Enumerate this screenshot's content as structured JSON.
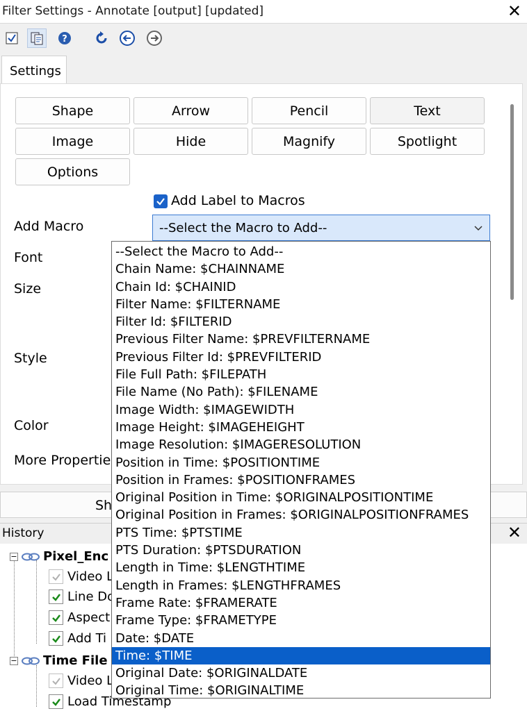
{
  "window": {
    "title": "Filter Settings - Annotate [output] [updated]",
    "close": "✕"
  },
  "toolbar": {
    "icons": [
      "apply-check-icon",
      "settings-copy-icon",
      "help-icon",
      "reset-icon",
      "back-arrow-icon",
      "forward-arrow-icon"
    ]
  },
  "tabs": [
    {
      "label": "Settings"
    }
  ],
  "tool_buttons": [
    "Shape",
    "Arrow",
    "Pencil",
    "Text",
    "Image",
    "Hide",
    "Magnify",
    "Spotlight",
    "Options"
  ],
  "add_label_checkbox": {
    "label": "Add Label to Macros",
    "checked": true
  },
  "form_labels": {
    "add_macro": "Add Macro",
    "font": "Font",
    "size": "Size",
    "style": "Style",
    "color": "Color",
    "more_properties": "More Properties"
  },
  "macro_select": {
    "value": "--Select the Macro to Add--"
  },
  "macro_options": [
    "--Select the Macro to Add--",
    "Chain Name: $CHAINNAME",
    "Chain Id: $CHAINID",
    "Filter Name: $FILTERNAME",
    "Filter Id: $FILTERID",
    "Previous Filter Name: $PREVFILTERNAME",
    "Previous Filter Id: $PREVFILTERID",
    "File Full Path: $FILEPATH",
    "File Name (No Path): $FILENAME",
    "Image Width: $IMAGEWIDTH",
    "Image Height: $IMAGEHEIGHT",
    "Image Resolution: $IMAGERESOLUTION",
    "Position in Time: $POSITIONTIME",
    "Position in Frames: $POSITIONFRAMES",
    "Original Position in Time: $ORIGINALPOSITIONTIME",
    "Original Position in Frames: $ORIGINALPOSITIONFRAMES",
    "PTS Time: $PTSTIME",
    "PTS Duration: $PTSDURATION",
    "Length in Time: $LENGTHTIME",
    "Length in Frames: $LENGTHFRAMES",
    "Frame Rate: $FRAMERATE",
    "Frame Type: $FRAMETYPE",
    "Date: $DATE",
    "Time: $TIME",
    "Original Date: $ORIGINALDATE",
    "Original Time: $ORIGINALTIME"
  ],
  "highlighted_option": "Time: $TIME",
  "show_button": {
    "label": "Sh"
  },
  "history": {
    "title": "History",
    "close": "✕",
    "group1": {
      "name": "Pixel_Enc",
      "items": [
        "Video L",
        "Line Do",
        "Aspect",
        "Add Ti"
      ]
    },
    "group2": {
      "name": "Time File",
      "items": [
        "Video L",
        "Load Timestamp"
      ]
    }
  },
  "colors": {
    "accent": "#1a62c9",
    "highlight": "#0a5fc9",
    "select_bg": "#d9e8fb"
  }
}
